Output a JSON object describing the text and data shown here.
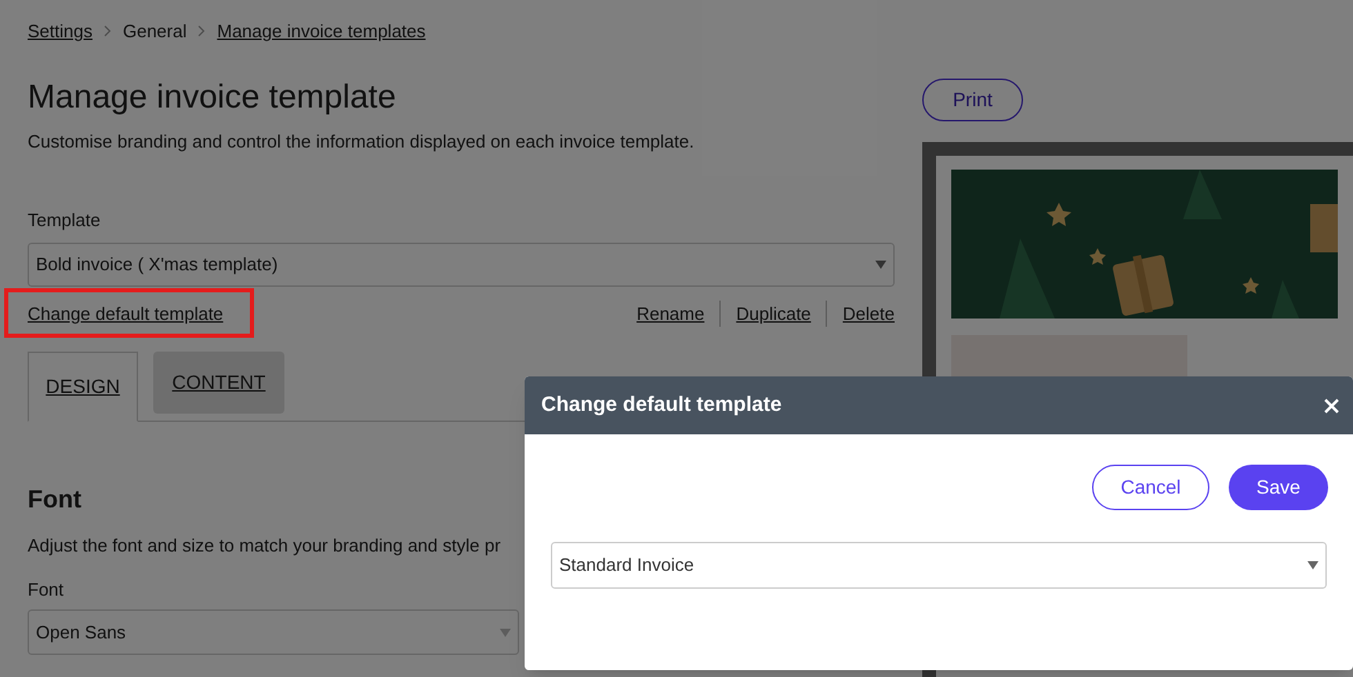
{
  "breadcrumb": [
    {
      "label": "Settings",
      "link": true
    },
    {
      "label": "General",
      "link": false
    },
    {
      "label": "Manage invoice templates",
      "link": true
    }
  ],
  "title": "Manage invoice template",
  "subtitle": "Customise branding and control the information displayed on each invoice template.",
  "template_field": {
    "label": "Template",
    "value": "Bold invoice ( X'mas template)"
  },
  "change_default_link": {
    "label": "Change default template",
    "highlighted": true
  },
  "actions": [
    "Rename",
    "Duplicate",
    "Delete"
  ],
  "tabs": [
    {
      "label": "DESIGN",
      "selected": true
    },
    {
      "label": "CONTENT",
      "selected": false
    }
  ],
  "font_section": {
    "heading": "Font",
    "description": "Adjust the font and size to match your branding and style pr",
    "field_label": "Font",
    "value": "Open Sans"
  },
  "print_button": "Print",
  "dialog": {
    "title": "Change default template",
    "cancel": "Cancel",
    "save": "Save",
    "value": "Standard Invoice"
  }
}
